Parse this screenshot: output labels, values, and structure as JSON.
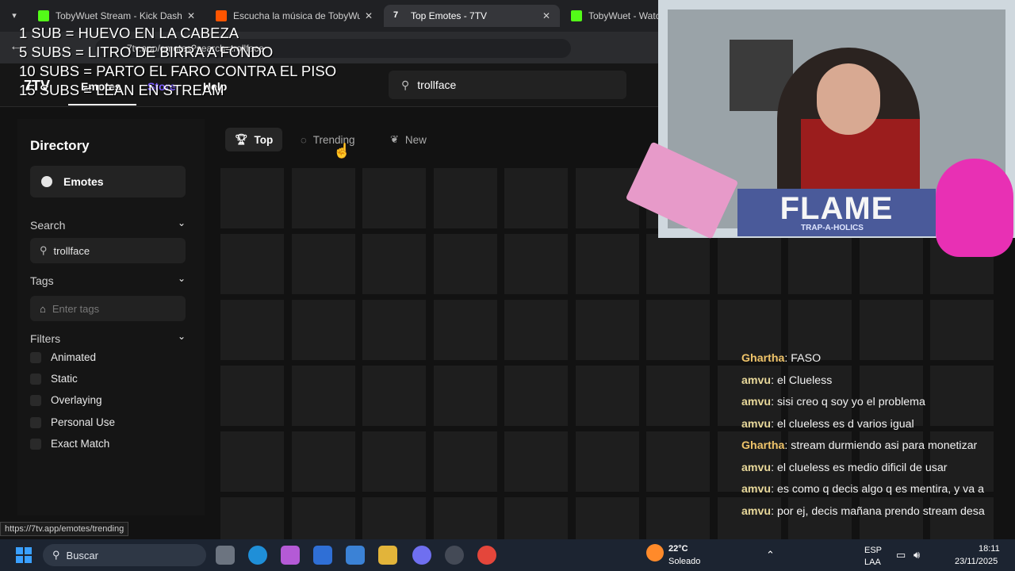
{
  "browser": {
    "tabs": [
      {
        "label": "TobyWuet Stream - Kick Dashb",
        "icon_color": "#53fc18",
        "active": false
      },
      {
        "label": "Escucha la música de TobyWuet",
        "icon_color": "#ff5500",
        "active": false
      },
      {
        "label": "Top Emotes - 7TV",
        "icon_color": "#ffffff",
        "active": true
      },
      {
        "label": "TobyWuet - Watc",
        "icon_color": "#53fc18",
        "active": false
      }
    ],
    "address": "7tv.app/emotes?search=trollface",
    "status_url": "https://7tv.app/emotes/trending"
  },
  "site": {
    "logo": "7TV",
    "nav": [
      "Emotes",
      "Store",
      "Help"
    ],
    "search_value": "trollface"
  },
  "sidebar": {
    "title": "Directory",
    "emotes_button": "Emotes",
    "search_label": "Search",
    "search_value": "trollface",
    "tags_label": "Tags",
    "tags_placeholder": "Enter tags",
    "filters_label": "Filters",
    "filters": [
      "Animated",
      "Static",
      "Overlaying",
      "Personal Use",
      "Exact Match"
    ]
  },
  "sort": [
    "Top",
    "Trending",
    "New"
  ],
  "overlay_text": [
    "1 SUB = HUEVO EN LA CABEZA",
    "5 SUBS = LITRO DE BIRRA A FONDO",
    "10 SUBS = PARTO EL FARO CONTRA EL PISO",
    "15 SUBS = LEAN EN STREAM"
  ],
  "banner": {
    "title": "FLAME",
    "subtitle": "TRAP-A-HOLICS"
  },
  "chat": [
    {
      "user": "Ghartha",
      "color": "#f0c46a",
      "text": "FASO"
    },
    {
      "user": "amvu",
      "color": "#e8d89a",
      "text": "el Clueless"
    },
    {
      "user": "amvu",
      "color": "#e8d89a",
      "text": "sisi creo q soy yo el problema"
    },
    {
      "user": "amvu",
      "color": "#e8d89a",
      "text": "el clueless es d varios igual"
    },
    {
      "user": "Ghartha",
      "color": "#f0c46a",
      "text": "stream durmiendo asi para monetizar"
    },
    {
      "user": "amvu",
      "color": "#e8d89a",
      "text": "el clueless es medio dificil de usar"
    },
    {
      "user": "amvu",
      "color": "#e8d89a",
      "text": "es como q decis algo q es mentira, y va a"
    },
    {
      "user": "amvu",
      "color": "#e8d89a",
      "text": "por ej, decis mañana prendo stream desa"
    }
  ],
  "taskbar": {
    "search_placeholder": "Buscar",
    "weather_temp": "22°C",
    "weather_desc": "Soleado",
    "lang1": "ESP",
    "lang2": "LAA",
    "time": "18:11",
    "date": "23/11/2025"
  }
}
